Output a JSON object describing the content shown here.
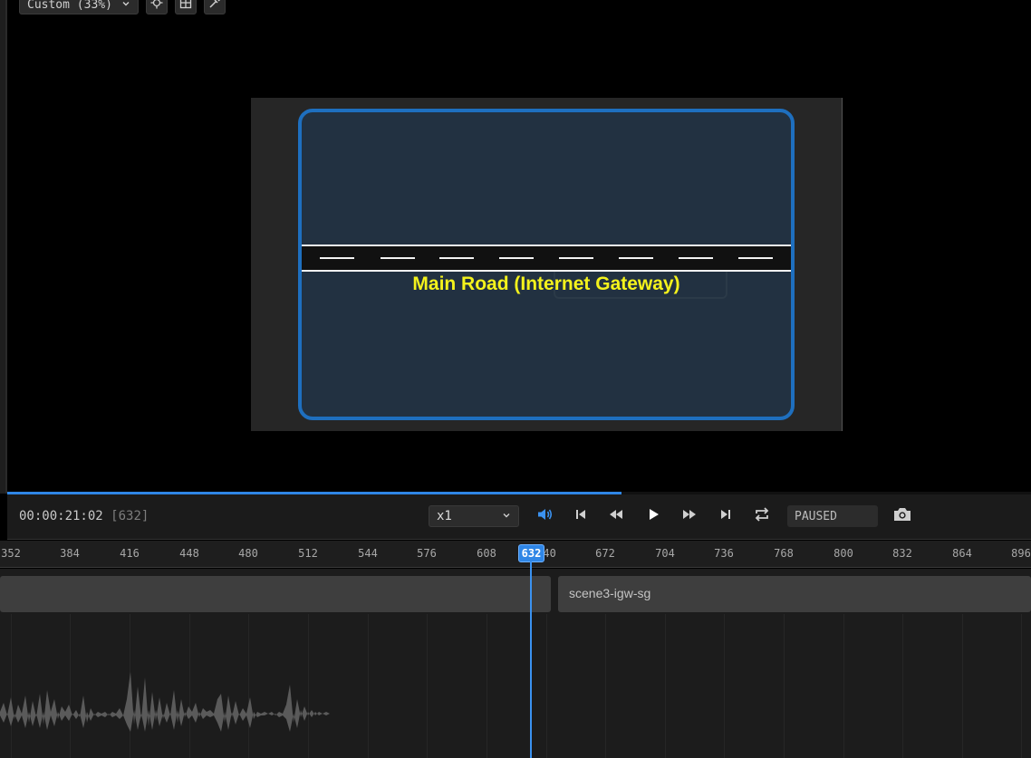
{
  "toolbar": {
    "zoom_label": "Custom (33%)"
  },
  "canvas": {
    "road_label": "Main Road (Internet Gateway)"
  },
  "playback": {
    "timecode": "00:00:21:02",
    "frame": "[632]",
    "speed": "x1",
    "status": "PAUSED",
    "progress_fraction": 0.6
  },
  "ruler": {
    "ticks": [
      "352",
      "384",
      "416",
      "448",
      "480",
      "512",
      "544",
      "576",
      "608",
      "640",
      "672",
      "704",
      "736",
      "768",
      "800",
      "832",
      "864",
      "896"
    ],
    "playhead_frame": "632"
  },
  "tracks": {
    "clip_b_name": "scene3-igw-sg"
  },
  "colors": {
    "accent": "#2f86e6",
    "vpc_border": "#1e6fbf",
    "road_label": "#f4f21c"
  }
}
